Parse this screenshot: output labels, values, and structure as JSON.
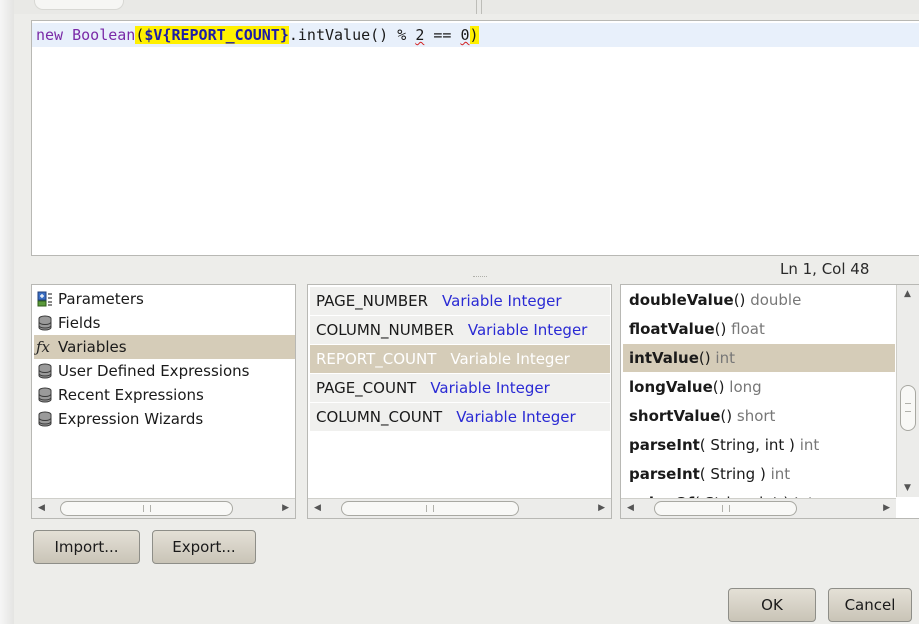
{
  "editor": {
    "code": {
      "t1": "new Boolean",
      "t2": "(",
      "t3": "$V{REPORT_COUNT}",
      "t4": ".intValue() % ",
      "t5": "2",
      "t6": " == ",
      "t7": "0",
      "t8": ")"
    },
    "cursor_position": "Ln 1, Col 48"
  },
  "categories": [
    {
      "label": "Parameters",
      "icon": "parameters-icon"
    },
    {
      "label": "Fields",
      "icon": "database-icon"
    },
    {
      "label": "Variables",
      "icon": "function-fx-icon",
      "selected": true
    },
    {
      "label": "User Defined Expressions",
      "icon": "database-icon"
    },
    {
      "label": "Recent Expressions",
      "icon": "database-icon"
    },
    {
      "label": "Expression Wizards",
      "icon": "database-icon"
    }
  ],
  "variables": [
    {
      "name": "PAGE_NUMBER",
      "type": "Variable Integer"
    },
    {
      "name": "COLUMN_NUMBER",
      "type": "Variable Integer"
    },
    {
      "name": "REPORT_COUNT",
      "type": "Variable Integer",
      "selected": true
    },
    {
      "name": "PAGE_COUNT",
      "type": "Variable Integer"
    },
    {
      "name": "COLUMN_COUNT",
      "type": "Variable Integer"
    }
  ],
  "methods": [
    {
      "name": "doubleValue",
      "args": "()",
      "ret": "double"
    },
    {
      "name": "floatValue",
      "args": "()",
      "ret": "float"
    },
    {
      "name": "intValue",
      "args": "()",
      "ret": "int",
      "selected": true
    },
    {
      "name": "longValue",
      "args": "()",
      "ret": "long"
    },
    {
      "name": "shortValue",
      "args": "()",
      "ret": "short"
    },
    {
      "name": "parseInt",
      "args": "( String, int )",
      "ret": "int"
    },
    {
      "name": "parseInt",
      "args": "( String )",
      "ret": "int"
    },
    {
      "name": "valueOf",
      "args": "( String, int )",
      "ret": "Integer"
    }
  ],
  "buttons": {
    "import": "Import...",
    "export": "Export...",
    "ok": "OK",
    "cancel": "Cancel"
  },
  "colors": {
    "selection": "#d5ccb8",
    "variable_type": "#2a2ad4",
    "brace_highlight": "#fff000",
    "current_line": "#e8f0fb"
  }
}
